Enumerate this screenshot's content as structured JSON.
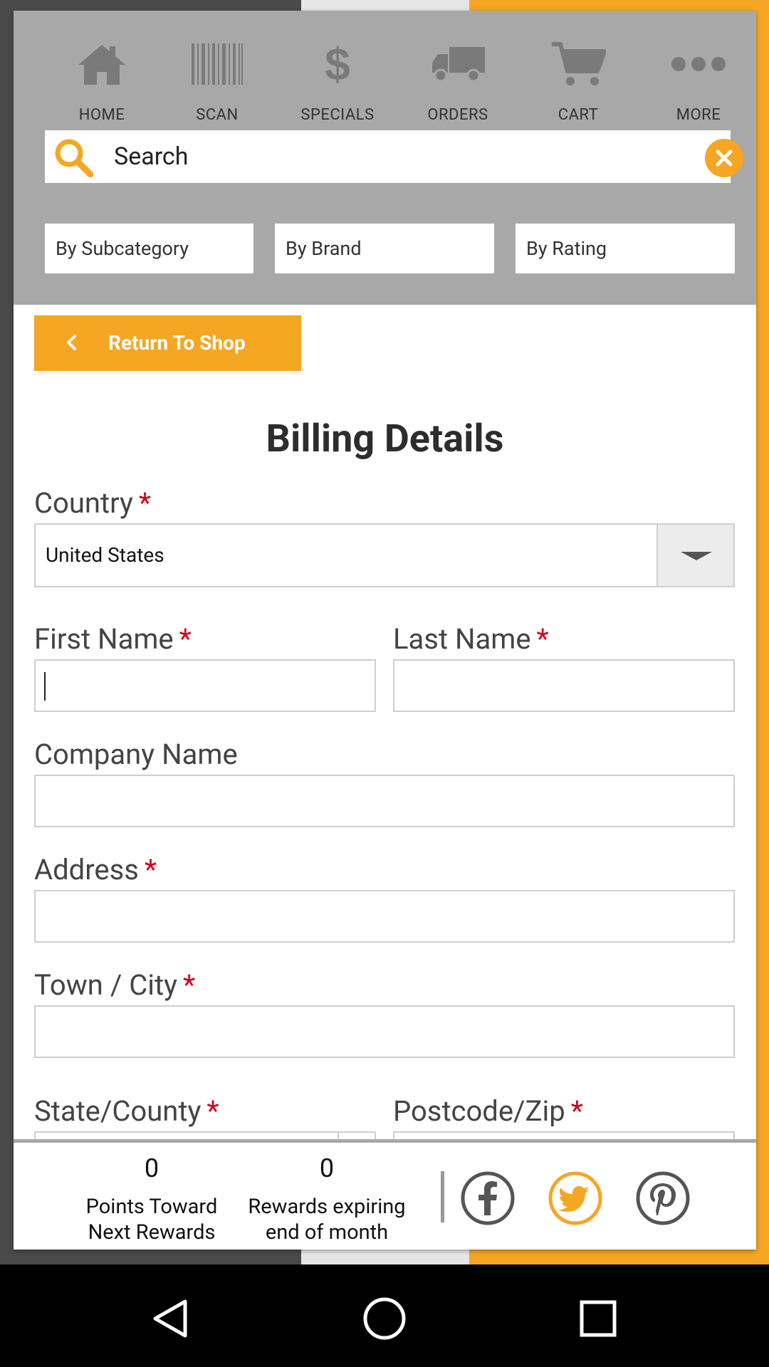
{
  "nav": {
    "items": [
      {
        "label": "HOME",
        "icon": "home-icon"
      },
      {
        "label": "SCAN",
        "icon": "barcode-icon"
      },
      {
        "label": "SPECIALS",
        "icon": "dollar-icon"
      },
      {
        "label": "ORDERS",
        "icon": "truck-icon"
      },
      {
        "label": "CART",
        "icon": "cart-icon"
      },
      {
        "label": "MORE",
        "icon": "more-icon"
      }
    ]
  },
  "search": {
    "placeholder": "Search"
  },
  "filters": [
    "By Subcategory",
    "By Brand",
    "By Rating"
  ],
  "return_button": "Return To Shop",
  "form": {
    "title": "Billing Details",
    "country_label": "Country",
    "country_value": "United States",
    "first_name_label": "First Name",
    "last_name_label": "Last Name",
    "company_label": "Company Name",
    "address_label": "Address",
    "city_label": "Town / City",
    "state_label": "State/County",
    "zip_label": "Postcode/Zip",
    "required_mark": "*"
  },
  "rewards": {
    "points_value": "0",
    "points_desc_line1": "Points Toward",
    "points_desc_line2": "Next Rewards",
    "expiring_value": "0",
    "expiring_desc_line1": "Rewards expiring",
    "expiring_desc_line2": "end of month"
  },
  "colors": {
    "accent": "#f5a623",
    "header_gray": "#a8a8a8",
    "required_red": "#d0021b"
  }
}
